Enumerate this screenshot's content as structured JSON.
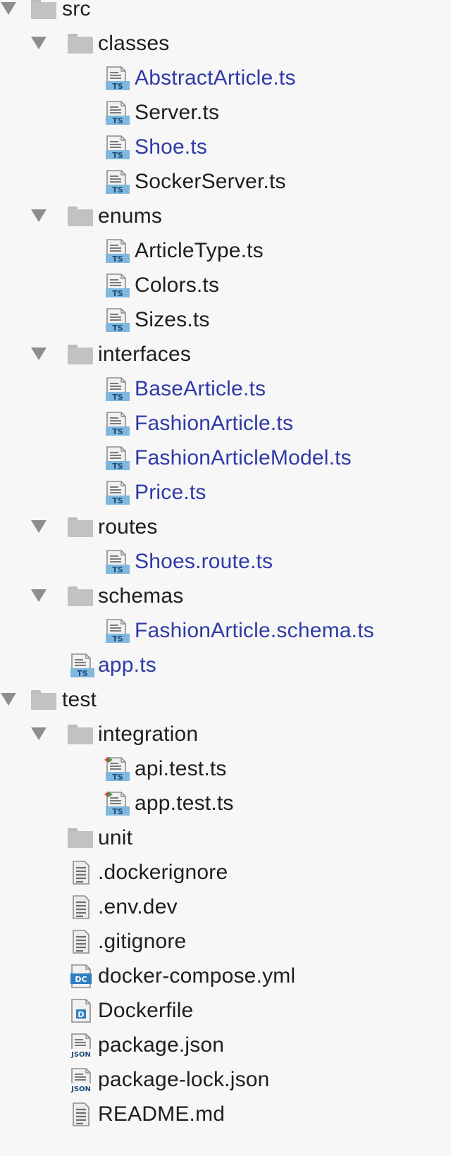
{
  "project_tree": {
    "items": [
      {
        "kind": "folder",
        "name": "src",
        "depth": 0,
        "expanded": true,
        "color": "black"
      },
      {
        "kind": "folder",
        "name": "classes",
        "depth": 1,
        "expanded": true,
        "color": "black"
      },
      {
        "kind": "file",
        "icon": "ts-file-icon",
        "name": "AbstractArticle.ts",
        "depth": 2,
        "color": "blue"
      },
      {
        "kind": "file",
        "icon": "ts-file-icon",
        "name": "Server.ts",
        "depth": 2,
        "color": "black"
      },
      {
        "kind": "file",
        "icon": "ts-file-icon",
        "name": "Shoe.ts",
        "depth": 2,
        "color": "blue"
      },
      {
        "kind": "file",
        "icon": "ts-file-icon",
        "name": "SockerServer.ts",
        "depth": 2,
        "color": "black"
      },
      {
        "kind": "folder",
        "name": "enums",
        "depth": 1,
        "expanded": true,
        "color": "black"
      },
      {
        "kind": "file",
        "icon": "ts-file-icon",
        "name": "ArticleType.ts",
        "depth": 2,
        "color": "black"
      },
      {
        "kind": "file",
        "icon": "ts-file-icon",
        "name": "Colors.ts",
        "depth": 2,
        "color": "black"
      },
      {
        "kind": "file",
        "icon": "ts-file-icon",
        "name": "Sizes.ts",
        "depth": 2,
        "color": "black"
      },
      {
        "kind": "folder",
        "name": "interfaces",
        "depth": 1,
        "expanded": true,
        "color": "black"
      },
      {
        "kind": "file",
        "icon": "ts-file-icon",
        "name": "BaseArticle.ts",
        "depth": 2,
        "color": "blue"
      },
      {
        "kind": "file",
        "icon": "ts-file-icon",
        "name": "FashionArticle.ts",
        "depth": 2,
        "color": "blue"
      },
      {
        "kind": "file",
        "icon": "ts-file-icon",
        "name": "FashionArticleModel.ts",
        "depth": 2,
        "color": "blue"
      },
      {
        "kind": "file",
        "icon": "ts-file-icon",
        "name": "Price.ts",
        "depth": 2,
        "color": "blue"
      },
      {
        "kind": "folder",
        "name": "routes",
        "depth": 1,
        "expanded": true,
        "color": "black"
      },
      {
        "kind": "file",
        "icon": "ts-file-icon",
        "name": "Shoes.route.ts",
        "depth": 2,
        "color": "blue"
      },
      {
        "kind": "folder",
        "name": "schemas",
        "depth": 1,
        "expanded": true,
        "color": "black"
      },
      {
        "kind": "file",
        "icon": "ts-file-icon",
        "name": "FashionArticle.schema.ts",
        "depth": 2,
        "color": "blue"
      },
      {
        "kind": "file",
        "icon": "ts-file-icon",
        "name": "app.ts",
        "depth": 1,
        "color": "blue"
      },
      {
        "kind": "folder",
        "name": "test",
        "depth": 0,
        "expanded": true,
        "color": "black"
      },
      {
        "kind": "folder",
        "name": "integration",
        "depth": 1,
        "expanded": true,
        "color": "black"
      },
      {
        "kind": "file",
        "icon": "ts-test-file-icon",
        "name": "api.test.ts",
        "depth": 2,
        "color": "black"
      },
      {
        "kind": "file",
        "icon": "ts-test-file-icon",
        "name": "app.test.ts",
        "depth": 2,
        "color": "black"
      },
      {
        "kind": "folder",
        "name": "unit",
        "depth": 1,
        "expanded": false,
        "color": "black"
      },
      {
        "kind": "file",
        "icon": "text-file-icon",
        "name": ".dockerignore",
        "depth": 1,
        "color": "black"
      },
      {
        "kind": "file",
        "icon": "text-file-icon",
        "name": ".env.dev",
        "depth": 1,
        "color": "black"
      },
      {
        "kind": "file",
        "icon": "text-file-icon",
        "name": ".gitignore",
        "depth": 1,
        "color": "black"
      },
      {
        "kind": "file",
        "icon": "docker-compose-file-icon",
        "name": "docker-compose.yml",
        "depth": 1,
        "color": "black"
      },
      {
        "kind": "file",
        "icon": "dockerfile-icon",
        "name": "Dockerfile",
        "depth": 1,
        "color": "black"
      },
      {
        "kind": "file",
        "icon": "json-file-icon",
        "name": "package.json",
        "depth": 1,
        "color": "black"
      },
      {
        "kind": "file",
        "icon": "json-file-icon",
        "name": "package-lock.json",
        "depth": 1,
        "color": "black"
      },
      {
        "kind": "file",
        "icon": "text-file-icon",
        "name": "README.md",
        "depth": 1,
        "color": "black"
      }
    ]
  },
  "icon_labels": {
    "ts": "TS",
    "json": "JSON",
    "docker_compose": "DC",
    "dockerfile": "D"
  },
  "colors": {
    "black": "#1e1e1e",
    "blue": "#2f3aa6",
    "background": "#f7f7f7",
    "ts_badge": "#7fb7dd",
    "folder": "#c2c2c2"
  }
}
